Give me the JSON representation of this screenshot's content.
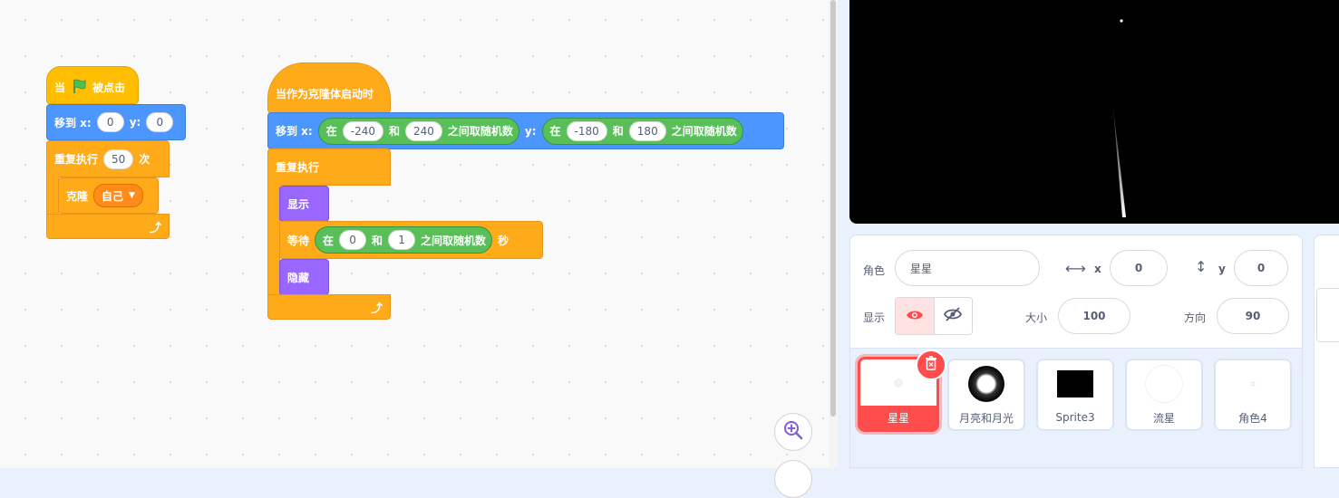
{
  "script1": {
    "when_label": "当",
    "clicked_label": "被点击",
    "flag_icon": "green-flag-icon",
    "goto_label": "移到 x:",
    "goto_x": "0",
    "goto_y_label": "y:",
    "goto_y": "0",
    "repeat_label": "重复执行",
    "repeat_count": "50",
    "repeat_times_label": "次",
    "clone_label": "克隆",
    "clone_target": "自己"
  },
  "script2": {
    "hat_label": "当作为克隆体启动时",
    "goto_label": "移到 x:",
    "rand_x_in": "在",
    "rand_x_from": "-240",
    "rand_x_and": "和",
    "rand_x_to": "240",
    "rand_x_suffix": "之间取随机数",
    "goto_y_label": "y:",
    "rand_y_in": "在",
    "rand_y_from": "-180",
    "rand_y_and": "和",
    "rand_y_to": "180",
    "rand_y_suffix": "之间取随机数",
    "forever_label": "重复执行",
    "show_label": "显示",
    "wait_label": "等待",
    "wait_in": "在",
    "wait_from": "0",
    "wait_and": "和",
    "wait_to": "1",
    "wait_suffix": "之间取随机数",
    "wait_unit": "秒",
    "hide_label": "隐藏"
  },
  "sprite_info": {
    "sprite_label": "角色",
    "sprite_name": "星星",
    "x_label": "x",
    "x_value": "0",
    "y_label": "y",
    "y_value": "0",
    "show_label": "显示",
    "size_label": "大小",
    "size_value": "100",
    "direction_label": "方向",
    "direction_value": "90"
  },
  "sprites": [
    {
      "name": "星星",
      "selected": true
    },
    {
      "name": "月亮和月光",
      "selected": false
    },
    {
      "name": "Sprite3",
      "selected": false
    },
    {
      "name": "流星",
      "selected": false
    },
    {
      "name": "角色4",
      "selected": false
    }
  ],
  "colors": {
    "events": "#ffbf00",
    "control": "#ffab19",
    "motion": "#4c97ff",
    "looks": "#9966ff",
    "operators": "#59c059",
    "selected": "#ff4c4c"
  }
}
